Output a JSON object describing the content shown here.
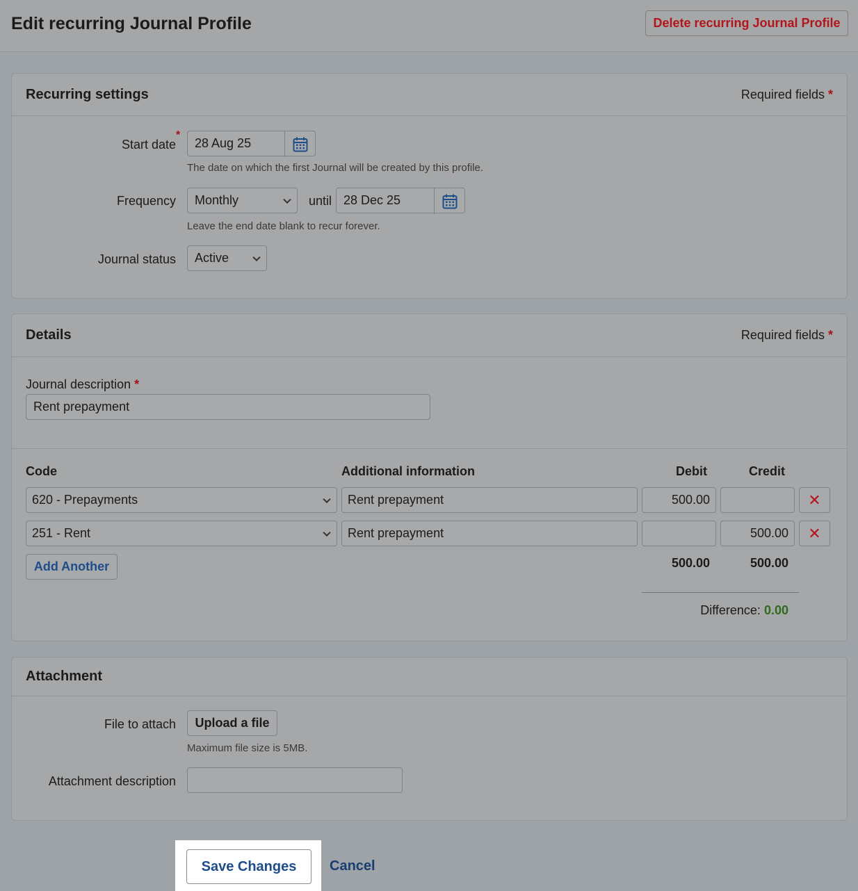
{
  "header": {
    "title": "Edit recurring Journal Profile",
    "delete_label": "Delete recurring Journal Profile"
  },
  "recurring": {
    "title": "Recurring settings",
    "required_label": "Required fields",
    "required_star": "*",
    "start_date_label": "Start date",
    "start_date_value": "28 Aug 25",
    "start_date_hint": "The date on which the first Journal will be created by this profile.",
    "frequency_label": "Frequency",
    "frequency_value": "Monthly",
    "until_label": "until",
    "until_value": "28 Dec 25",
    "frequency_hint": "Leave the end date blank to recur forever.",
    "status_label": "Journal status",
    "status_value": "Active"
  },
  "details": {
    "title": "Details",
    "required_label": "Required fields",
    "required_star": "*",
    "description_label": "Journal description",
    "description_value": "Rent prepayment",
    "columns": {
      "code": "Code",
      "info": "Additional information",
      "debit": "Debit",
      "credit": "Credit"
    },
    "lines": [
      {
        "code": "620 - Prepayments",
        "info": "Rent prepayment",
        "debit": "500.00",
        "credit": ""
      },
      {
        "code": "251 - Rent",
        "info": "Rent prepayment",
        "debit": "",
        "credit": "500.00"
      }
    ],
    "remove_glyph": "✕",
    "add_label": "Add Another",
    "total_debit": "500.00",
    "total_credit": "500.00",
    "difference_label": "Difference:",
    "difference_value": "0.00",
    "difference_color": "#2e6b1f"
  },
  "attachment": {
    "title": "Attachment",
    "file_label": "File to attach",
    "upload_label": "Upload a file",
    "file_hint": "Maximum file size is 5MB.",
    "desc_label": "Attachment description",
    "desc_value": ""
  },
  "footer": {
    "save_label": "Save Changes",
    "cancel_label": "Cancel"
  },
  "icons": {
    "calendar": "calendar-icon",
    "chevron": "chevron-down-icon",
    "remove": "close-icon"
  },
  "colors": {
    "danger": "#b3151d",
    "link": "#1e4d8c"
  }
}
